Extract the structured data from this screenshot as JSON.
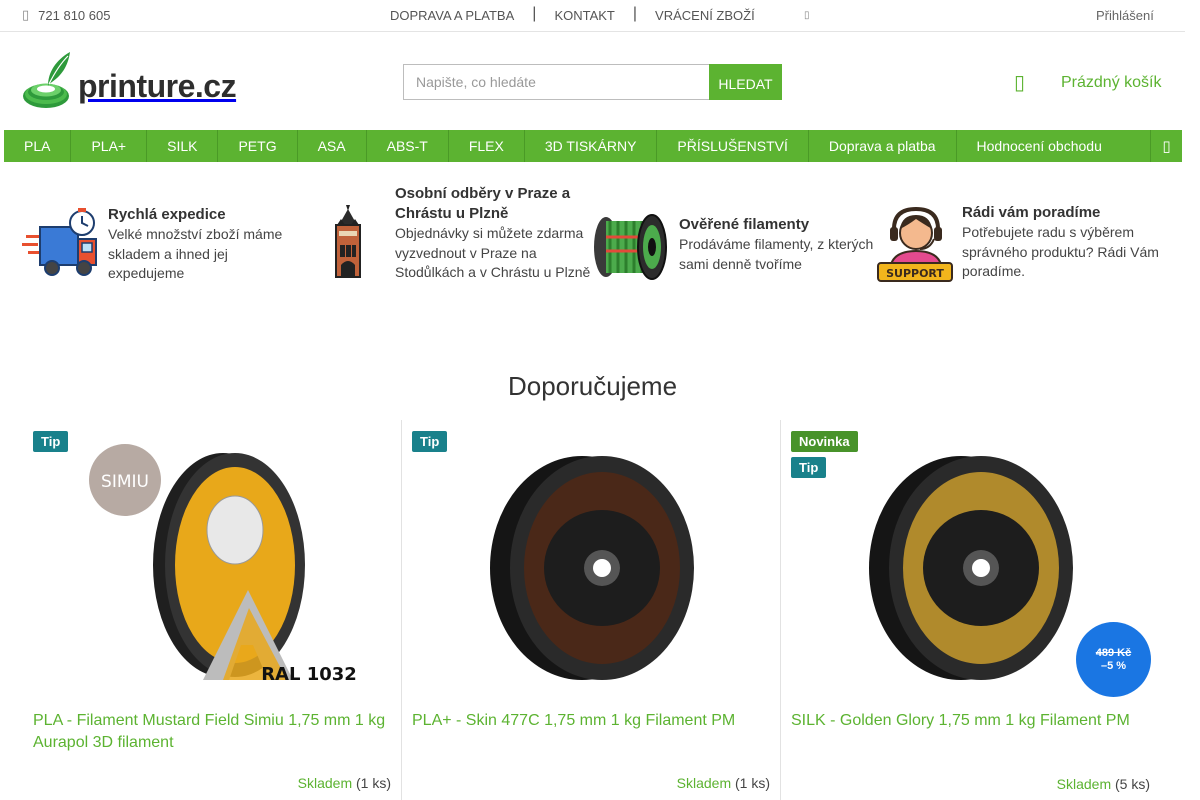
{
  "topbar": {
    "phone": "721 810 605",
    "links": [
      "DOPRAVA A PLATBA",
      "KONTAKT",
      "VRÁCENÍ ZBOŽÍ"
    ],
    "login": "Přihlášení"
  },
  "header": {
    "logo_text": "printure.cz",
    "search_placeholder": "Napište, co hledáte",
    "search_button": "HLEDAT",
    "cart_label": "Prázdný košík"
  },
  "nav": {
    "items": [
      "PLA",
      "PLA+",
      "SILK",
      "PETG",
      "ASA",
      "ABS-T",
      "FLEX",
      "3D TISKÁRNY",
      "PŘÍSLUŠENSTVÍ",
      "Doprava a platba",
      "Hodnocení obchodu"
    ]
  },
  "benefits": [
    {
      "title": "Rychlá expedice",
      "desc": "Velké množství zboží máme skladem a ihned jej expedujeme",
      "icon": "truck-icon"
    },
    {
      "title": "Osobní odběry v Praze a Chrástu u Plzně",
      "desc": "Objednávky si můžete zdarma vyzvednout v Praze na Stodůlkách a v Chrástu u Plzně",
      "icon": "tower-icon"
    },
    {
      "title": "Ověřené filamenty",
      "desc": "Prodáváme filamenty, z kterých sami denně tvoříme",
      "icon": "spool-icon"
    },
    {
      "title": "Rádi vám poradíme",
      "desc": "Potřebujete radu s výběrem správného produktu? Rádi Vám poradíme.",
      "icon": "support-icon",
      "badge": "SUPPORT"
    }
  ],
  "section_title": "Doporučujeme",
  "products": [
    {
      "flags": [
        "Tip"
      ],
      "name": "PLA - Filament Mustard Field Simiu 1,75 mm 1 kg Aurapol 3D filament",
      "stock": "Skladem",
      "qty": "(1 ks)",
      "filament_color": "#e8a81a",
      "img_brand": "SIMIU",
      "img_code": "RAL 1032"
    },
    {
      "flags": [
        "Tip"
      ],
      "name": "PLA+ - Skin 477C 1,75 mm 1 kg Filament PM",
      "stock": "Skladem",
      "qty": "(1 ks)",
      "filament_color": "#4a2818"
    },
    {
      "flags": [
        "Novinka",
        "Tip"
      ],
      "name": "SILK - Golden Glory 1,75 mm 1 kg Filament PM",
      "stock": "Skladem",
      "qty": "(5 ks)",
      "filament_color": "#b08a2c"
    }
  ],
  "discount": {
    "old_price": "489 Kč",
    "percent": "–5 %"
  }
}
